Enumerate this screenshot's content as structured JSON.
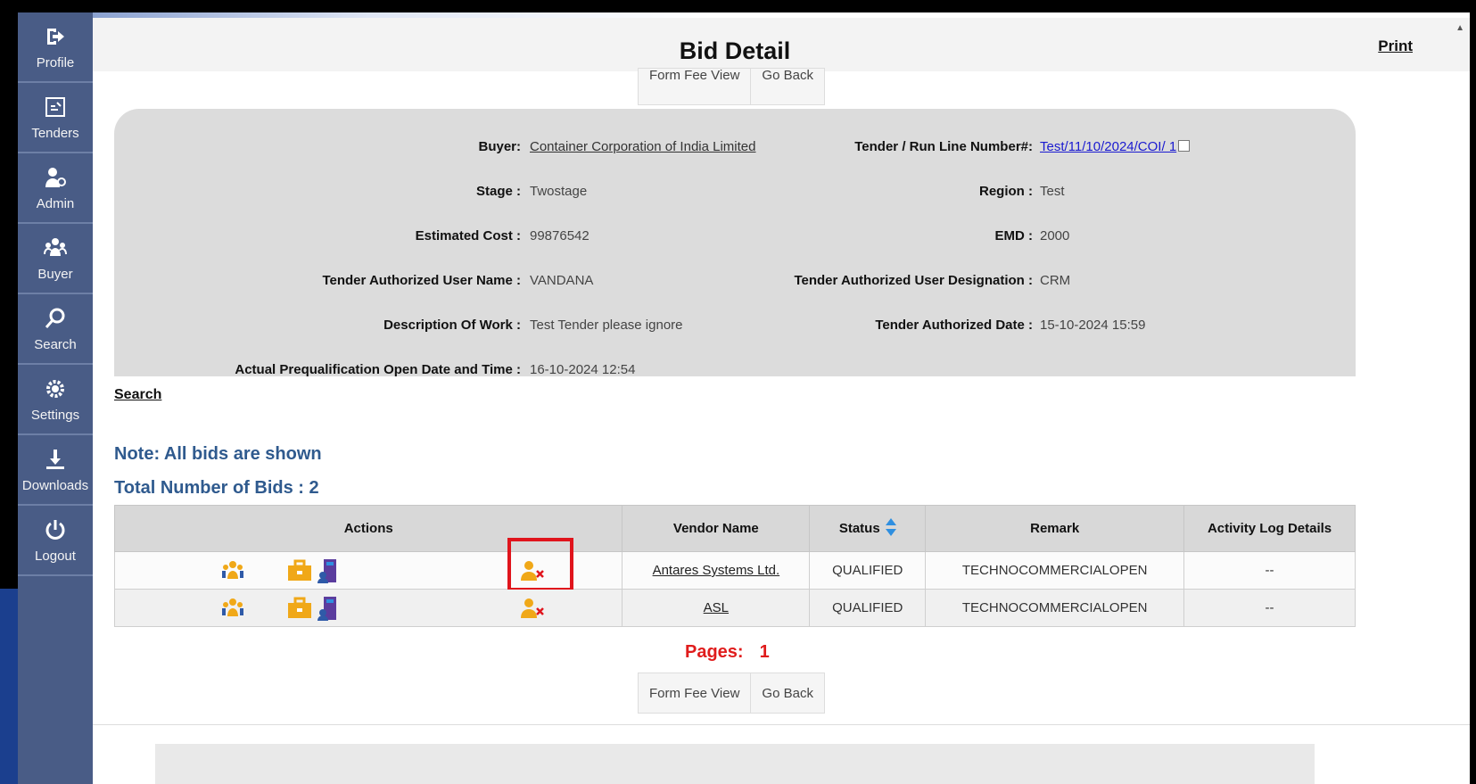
{
  "sidebar": {
    "items": [
      {
        "label": "Profile",
        "icon": "sign-in-icon"
      },
      {
        "label": "Tenders",
        "icon": "tender-doc-icon"
      },
      {
        "label": "Admin",
        "icon": "admin-user-icon"
      },
      {
        "label": "Buyer",
        "icon": "users-group-icon"
      },
      {
        "label": "Search",
        "icon": "search-icon"
      },
      {
        "label": "Settings",
        "icon": "gear-icon"
      },
      {
        "label": "Downloads",
        "icon": "download-icon"
      },
      {
        "label": "Logout",
        "icon": "power-icon"
      }
    ]
  },
  "header": {
    "title": "Bid Detail",
    "print": "Print"
  },
  "buttons": {
    "form_fee_view": "Form Fee View",
    "go_back": "Go Back"
  },
  "details": {
    "buyer_label": "Buyer:",
    "buyer_value": "Container Corporation of India Limited",
    "tender_label": "Tender / Run Line Number#:",
    "tender_value": "Test/11/10/2024/COI",
    "tender_suffix": "/ 1",
    "stage_label": "Stage :",
    "stage_value": "Twostage",
    "region_label": "Region :",
    "region_value": "Test",
    "cost_label": "Estimated Cost :",
    "cost_value": "99876542",
    "emd_label": "EMD :",
    "emd_value": "2000",
    "auth_user_label": "Tender Authorized User Name :",
    "auth_user_value": "VANDANA",
    "auth_desig_label": "Tender Authorized User Designation :",
    "auth_desig_value": "CRM",
    "desc_label": "Description Of Work :",
    "desc_value": "Test Tender please ignore",
    "auth_date_label": "Tender Authorized Date :",
    "auth_date_value": "15-10-2024 15:59",
    "prequal_label": "Actual Prequalification Open Date and Time :",
    "prequal_value": "16-10-2024 12:54"
  },
  "search_link": "Search",
  "note": "Note: All bids are shown",
  "total": "Total Number of Bids : 2",
  "table": {
    "headers": [
      "Actions",
      "Vendor Name",
      "Status",
      "Remark",
      "Activity Log Details"
    ],
    "rows": [
      {
        "vendor": "Antares Systems Ltd.",
        "status": "QUALIFIED",
        "remark": "TECHNOCOMMERCIALOPEN",
        "log": "--"
      },
      {
        "vendor": "ASL",
        "status": "QUALIFIED",
        "remark": "TECHNOCOMMERCIALOPEN",
        "log": "--"
      }
    ]
  },
  "pages": {
    "label": "Pages:",
    "current": "1"
  },
  "colors": {
    "sidebar": "#495c86",
    "accent_red": "#e0141c",
    "note_blue": "#2f5a8e",
    "link_blue": "#1a1ad0",
    "icon_orange": "#f0a818",
    "icon_purple": "#5b3d9e"
  }
}
